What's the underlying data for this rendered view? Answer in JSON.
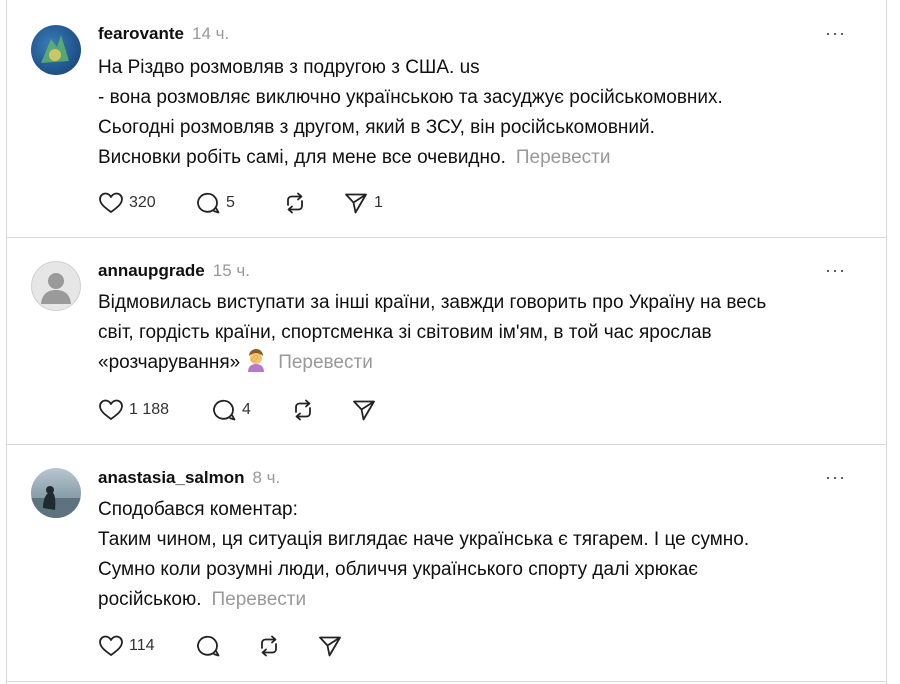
{
  "posts": [
    {
      "username": "fearovante",
      "time": "14 ч.",
      "lines": [
        "На Різдво розмовляв з подругою з США. us",
        "- вона розмовляє виключно українською та засуджує російськомовних.",
        "Сьогодні розмовляв з другом, який в ЗСУ, він російськомовний.",
        "Висновки робіть самі, для мене все очевидно."
      ],
      "translate": "Перевести",
      "likes": "320",
      "replies": "5",
      "reposts": "",
      "shares": "1"
    },
    {
      "username": "annaupgrade",
      "time": "15 ч.",
      "lines": [
        "Відмовилась виступати за інші країни, завжди говорить про Україну на весь",
        "світ, гордість країни, спортсменка зі світовим ім'ям, в той час ярослав",
        "«розчарування»"
      ],
      "translate": "Перевести",
      "likes": "1 188",
      "replies": "4",
      "reposts": "",
      "shares": ""
    },
    {
      "username": "anastasia_salmon",
      "time": "8 ч.",
      "lines": [
        "Сподобався коментар:",
        "Таким чином, ця ситуація виглядає наче українська є тягарем. І це сумно.",
        "Сумно коли розумні люди, обличчя українського спорту далі хрюкає",
        "російською."
      ],
      "translate": "Перевести",
      "likes": "114",
      "replies": "",
      "reposts": "",
      "shares": ""
    }
  ],
  "more_label": "···",
  "colors": {
    "text": "#101010",
    "muted": "#999999",
    "divider": "#d9d9d9"
  },
  "icons": {
    "like": "heart-icon",
    "reply": "comment-icon",
    "repost": "repost-icon",
    "share": "send-icon",
    "more": "more-icon"
  }
}
